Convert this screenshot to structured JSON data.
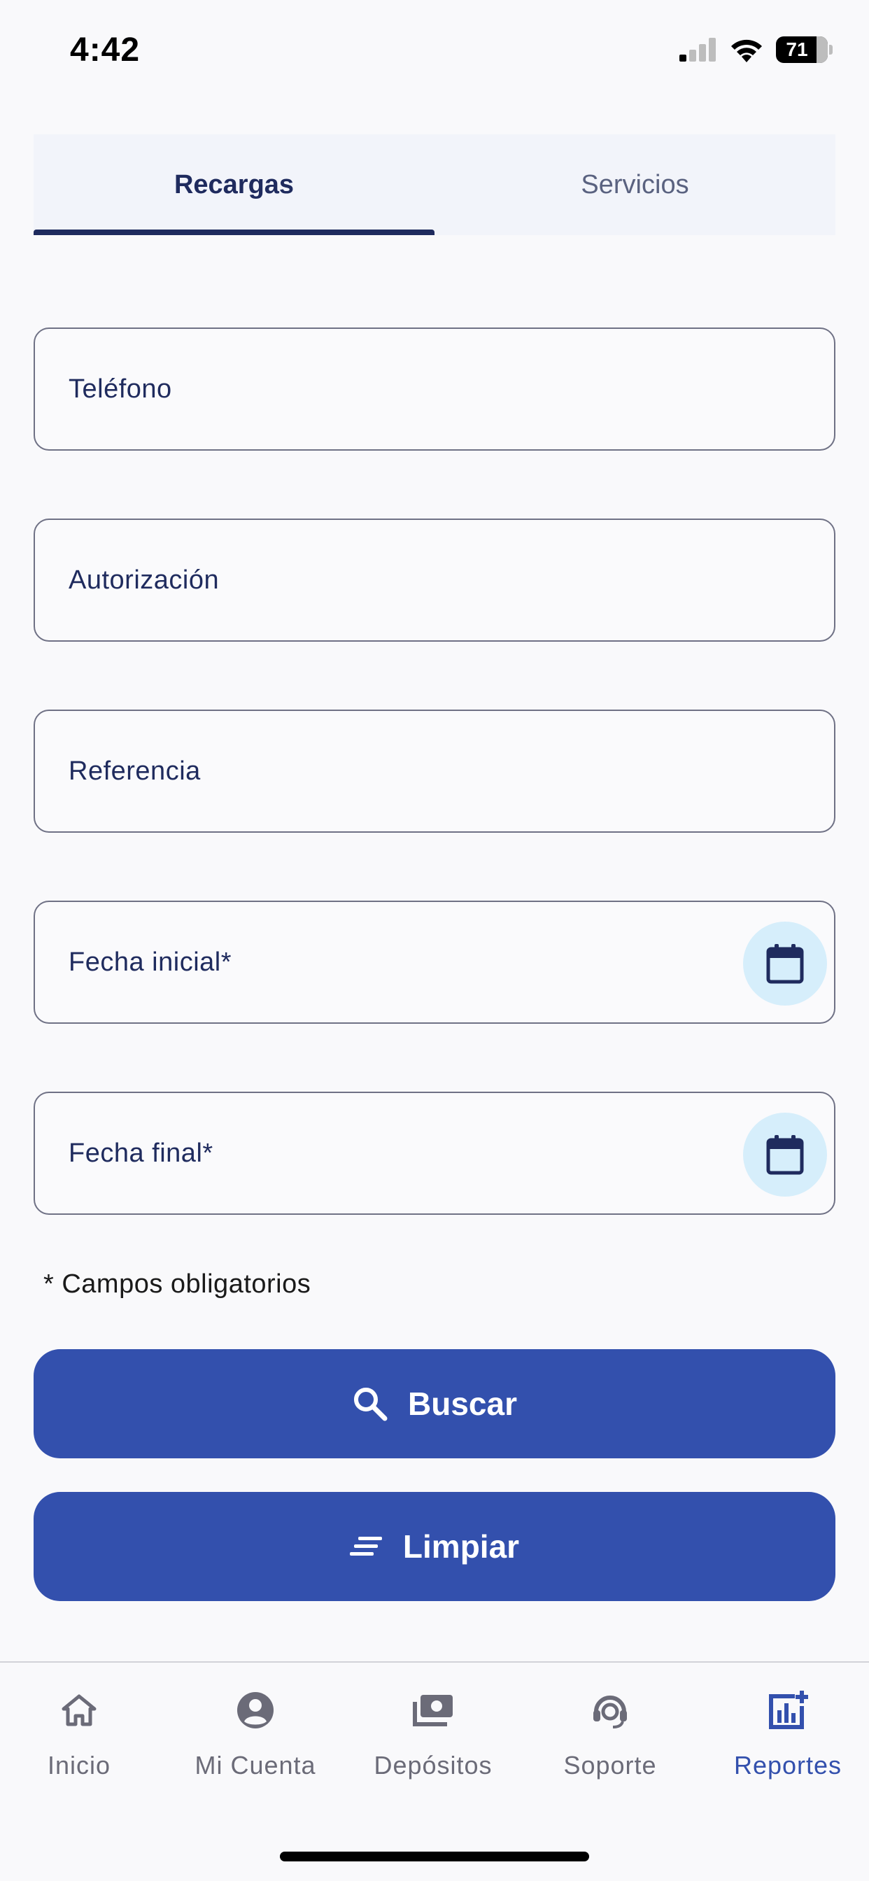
{
  "status_bar": {
    "time": "4:42",
    "battery": "71"
  },
  "tabs": [
    {
      "label": "Recargas",
      "active": true
    },
    {
      "label": "Servicios",
      "active": false
    }
  ],
  "form": {
    "fields": [
      {
        "label": "Teléfono",
        "value": ""
      },
      {
        "label": "Autorización",
        "value": ""
      },
      {
        "label": "Referencia",
        "value": ""
      },
      {
        "label": "Fecha inicial*",
        "value": "",
        "icon": "calendar-icon"
      },
      {
        "label": "Fecha final*",
        "value": "",
        "icon": "calendar-icon"
      }
    ],
    "required_note": "* Campos obligatorios",
    "search_button": {
      "label": "Buscar",
      "icon": "search-icon"
    },
    "clear_button": {
      "label": "Limpiar",
      "icon": "clear-lines-icon"
    }
  },
  "bottom_nav": {
    "items": [
      {
        "label": "Inicio",
        "icon": "home-icon",
        "active": false
      },
      {
        "label": "Mi Cuenta",
        "icon": "account-icon",
        "active": false
      },
      {
        "label": "Depósitos",
        "icon": "deposits-icon",
        "active": false
      },
      {
        "label": "Soporte",
        "icon": "support-icon",
        "active": false
      },
      {
        "label": "Reportes",
        "icon": "reports-icon",
        "active": true
      }
    ]
  },
  "colors": {
    "primary": "#3350ad",
    "navy": "#1f2b5e",
    "calendar_bg": "#d6eefb",
    "background": "#f9f9fb"
  }
}
